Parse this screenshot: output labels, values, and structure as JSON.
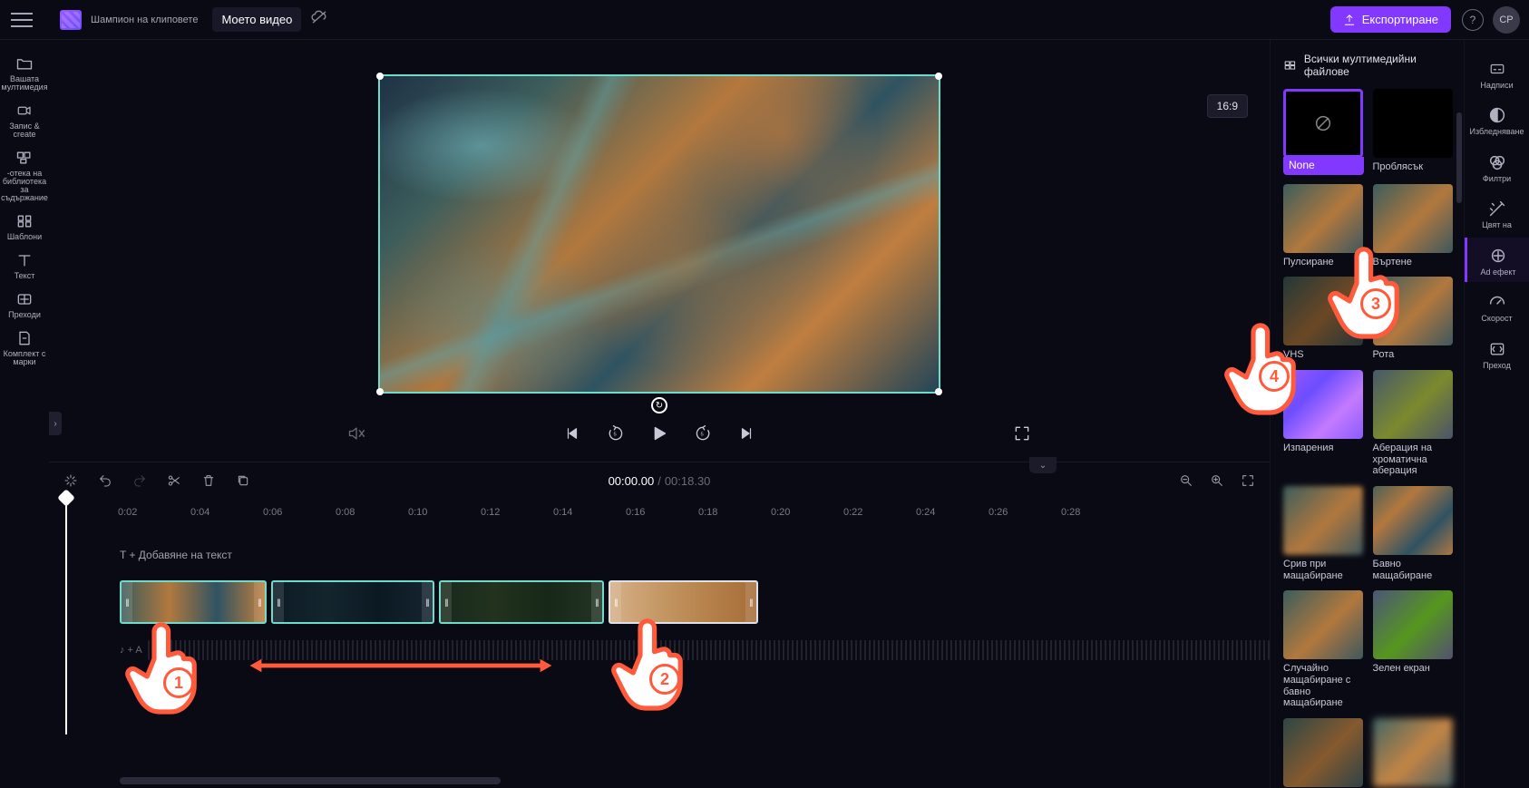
{
  "header": {
    "app_label": "Шампион на клиповете",
    "project_title": "Моето видео",
    "export_label": "Експортиране",
    "avatar": "CP"
  },
  "left_rail": [
    {
      "key": "media-icon",
      "label": "Вашата мултимедия"
    },
    {
      "key": "camera-icon",
      "label": "Запис & create"
    },
    {
      "key": "library-icon",
      "label": "-отека на библиотека за съдържание"
    },
    {
      "key": "templates-icon",
      "label": "Шаблони"
    },
    {
      "key": "text-icon",
      "label": "Текст"
    },
    {
      "key": "transitions-icon",
      "label": "Преходи"
    },
    {
      "key": "brandkit-icon",
      "label": "Комплект с марки"
    }
  ],
  "right_rail": [
    {
      "key": "captions-icon",
      "label": "Надписи"
    },
    {
      "key": "fade-icon",
      "label": "Избледняване"
    },
    {
      "key": "filters-icon",
      "label": "Филтри"
    },
    {
      "key": "color-icon",
      "label": "Цвят на"
    },
    {
      "key": "effects-icon",
      "label": "Ad ефект"
    },
    {
      "key": "speed-icon",
      "label": "Скорост"
    },
    {
      "key": "fit-icon",
      "label": "Преход"
    }
  ],
  "canvas": {
    "aspect_label": "16:9"
  },
  "effects_panel": {
    "heading": "Всички мултимедийни файлове",
    "items": [
      {
        "key": "none",
        "label": "None"
      },
      {
        "key": "flash",
        "label": "Проблясък"
      },
      {
        "key": "pulse",
        "label": "Пулсиране"
      },
      {
        "key": "spin",
        "label": "Въртене"
      },
      {
        "key": "vhs",
        "label": "VHS"
      },
      {
        "key": "rotate",
        "label": "Рота"
      },
      {
        "key": "vapor",
        "label": "Изпарения"
      },
      {
        "key": "chroma",
        "label": "Аберация на хроматична аберация"
      },
      {
        "key": "zoom-crash",
        "label": "Срив при мащабиране"
      },
      {
        "key": "slow-zoom",
        "label": "Бавно мащабиране"
      },
      {
        "key": "rand-zoom",
        "label": "Случайно мащабиране с бавно мащабиране"
      },
      {
        "key": "green",
        "label": "Зелен екран"
      }
    ]
  },
  "timecode": {
    "current": "00:00.00",
    "separator": "/",
    "duration": "00:18.30"
  },
  "ruler": [
    "0:02",
    "0:04",
    "0:06",
    "0:08",
    "0:10",
    "0:12",
    "0:14",
    "0:16",
    "0:18",
    "0:20",
    "0:22",
    "0:24",
    "0:26",
    "0:28"
  ],
  "tracks": {
    "text_hint": "T + Добавяне на текст",
    "audio_hint": "♪  + A"
  },
  "callouts": {
    "n1": "1",
    "n2": "2",
    "n3": "3",
    "n4": "4"
  }
}
